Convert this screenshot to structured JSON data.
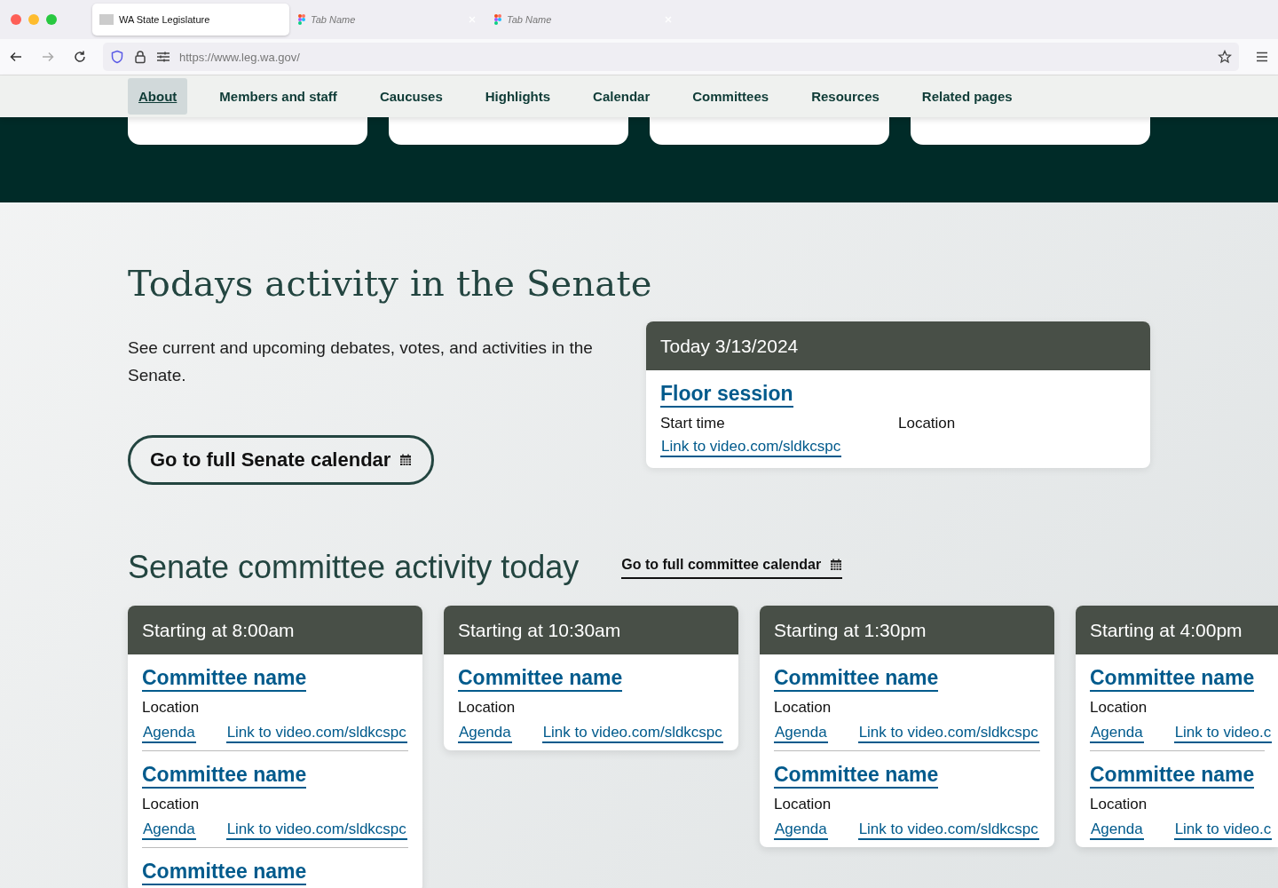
{
  "browser": {
    "tabs": [
      {
        "title": "WA State Legislature",
        "selected": true,
        "kind": "site"
      },
      {
        "title": "Tab Name",
        "selected": false,
        "kind": "design"
      },
      {
        "title": "Tab Name",
        "selected": false,
        "kind": "design"
      }
    ],
    "url": "https://www.leg.wa.gov/"
  },
  "nav": [
    {
      "label": "About",
      "selected": true
    },
    {
      "label": "Members and staff",
      "selected": false
    },
    {
      "label": "Caucuses",
      "selected": false
    },
    {
      "label": "Highlights",
      "selected": false
    },
    {
      "label": "Calendar",
      "selected": false
    },
    {
      "label": "Committees",
      "selected": false
    },
    {
      "label": "Resources",
      "selected": false
    },
    {
      "label": "Related pages",
      "selected": false
    }
  ],
  "senate": {
    "title": "Todays activity in the Senate",
    "intro": "See current and upcoming debates, votes, and activities in the Senate.",
    "calendar_button": "Go to full Senate calendar",
    "today": {
      "date": "Today 3/13/2024",
      "event": {
        "title": "Floor session",
        "start_label": "Start time",
        "location": "Location",
        "video": "Link to video.com/sldkcspc"
      }
    }
  },
  "committees": {
    "title": "Senate committee activity today",
    "calendar_link": "Go to full committee calendar",
    "columns": [
      {
        "heading": "Starting at 8:00am",
        "meetings": [
          {
            "name": "Committee name",
            "location": "Location",
            "agenda": "Agenda",
            "video": "Link to video.com/sldkcspc"
          },
          {
            "name": "Committee name",
            "location": "Location",
            "agenda": "Agenda",
            "video": "Link to video.com/sldkcspc"
          },
          {
            "name": "Committee name"
          }
        ]
      },
      {
        "heading": "Starting at 10:30am",
        "meetings": [
          {
            "name": "Committee name",
            "location": "Location",
            "agenda": "Agenda",
            "video": "Link to video.com/sldkcspc"
          }
        ]
      },
      {
        "heading": "Starting at 1:30pm",
        "meetings": [
          {
            "name": "Committee name",
            "location": "Location",
            "agenda": "Agenda",
            "video": "Link to video.com/sldkcspc"
          },
          {
            "name": "Committee name",
            "location": "Location",
            "agenda": "Agenda",
            "video": "Link to video.com/sldkcspc"
          }
        ]
      },
      {
        "heading": "Starting at 4:00pm",
        "meetings": [
          {
            "name": "Committee name",
            "location": "Location",
            "agenda": "Agenda",
            "video": "Link to video.c"
          },
          {
            "name": "Committee name",
            "location": "Location",
            "agenda": "Agenda",
            "video": "Link to video.c"
          }
        ]
      }
    ]
  }
}
